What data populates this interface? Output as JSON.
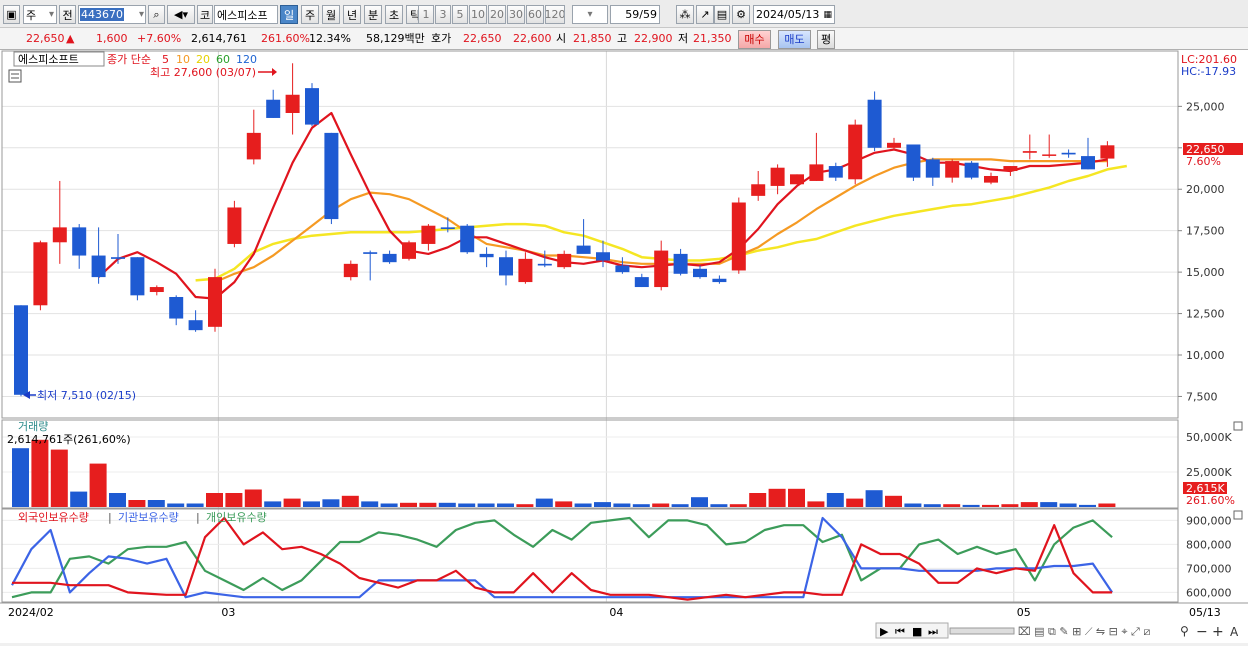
{
  "toolbar": {
    "market": "주",
    "period_prefix": "전",
    "code": "443670",
    "type_label": "코",
    "stock_name": "에스피소프",
    "periods": [
      "일",
      "주",
      "월",
      "년",
      "분",
      "초",
      "틱"
    ],
    "active_period": "일",
    "minute_opts": [
      "1",
      "3",
      "5",
      "10",
      "20",
      "30",
      "60",
      "120"
    ],
    "count": "59",
    "count_total": "/59",
    "date": "2024/05/13"
  },
  "quote": {
    "price": "22,650",
    "arrow": "▲",
    "change": "1,600",
    "change_pct": "+7.60%",
    "volume": "2,614,761",
    "vol_ratio": "261.60%",
    "turnover": "12.34%",
    "amount": "58,129백만",
    "hoga_label": "호가",
    "ask": "22,650",
    "bid": "22,600",
    "open_label": "시",
    "open": "21,850",
    "high_label": "고",
    "high": "22,900",
    "low_label": "저",
    "low": "21,350",
    "buy": "매수",
    "sell": "매도",
    "eval": "평"
  },
  "colors": {
    "up": "#e61e1e",
    "down": "#1e5ad2",
    "ma5": "#e0141e",
    "ma10": "#f59a23",
    "ma20": "#f5e623",
    "ma60": "#2aa02a",
    "ma120": "#1e64d2",
    "foreign": "#e0141e",
    "inst": "#3c64e6",
    "person": "#3c9c5a"
  },
  "chart_data": [
    {
      "type": "candlestick",
      "title": "에스피소프트",
      "legend_prefix": "종가 단순",
      "ma_periods": [
        "5",
        "10",
        "20",
        "60",
        "120"
      ],
      "high_note": "최고 27,600 (03/07)",
      "low_note": "최저 7,510 (02/15)",
      "right_top": [
        "LC:201.60",
        "HC:-17.93"
      ],
      "last_price_label": "22,650",
      "last_pct_label": "7.60%",
      "yticks": [
        "25,000",
        "22,500",
        "20,000",
        "17,500",
        "15,000",
        "12,500",
        "10,000",
        "7,500"
      ],
      "ytick_values": [
        25000,
        22500,
        20000,
        17500,
        15000,
        12500,
        10000,
        7500
      ],
      "ylim": [
        6200,
        28400
      ],
      "x_labels": [
        "2024/02",
        "03",
        "04",
        "05",
        "05/13"
      ],
      "x_label_index": [
        0,
        11,
        31,
        52,
        58
      ],
      "candles": [
        [
          13000,
          13000,
          7510,
          7600
        ],
        [
          13000,
          16900,
          12700,
          16800
        ],
        [
          16800,
          20500,
          15500,
          17700
        ],
        [
          17700,
          17900,
          15200,
          16000
        ],
        [
          16000,
          17700,
          14300,
          14700
        ],
        [
          15900,
          17300,
          15500,
          15800
        ],
        [
          15900,
          15900,
          13300,
          13600
        ],
        [
          13800,
          14200,
          13600,
          14100
        ],
        [
          13500,
          13600,
          11800,
          12200
        ],
        [
          12100,
          12700,
          11400,
          11500
        ],
        [
          11700,
          15200,
          11400,
          14700
        ],
        [
          16700,
          19300,
          16500,
          18900
        ],
        [
          21800,
          24800,
          21500,
          23400
        ],
        [
          25400,
          26000,
          24300,
          24300
        ],
        [
          24600,
          27600,
          23300,
          25700
        ],
        [
          26100,
          26400,
          23800,
          23900
        ],
        [
          23400,
          23400,
          17900,
          18200
        ],
        [
          14700,
          15700,
          14500,
          15500
        ],
        [
          16200,
          16300,
          14500,
          16100
        ],
        [
          16100,
          16300,
          15500,
          15600
        ],
        [
          15800,
          16900,
          15700,
          16800
        ],
        [
          16700,
          17900,
          16300,
          17800
        ],
        [
          17700,
          18300,
          17400,
          17600
        ],
        [
          17800,
          17900,
          16100,
          16200
        ],
        [
          16100,
          16500,
          15300,
          15900
        ],
        [
          15900,
          16300,
          14200,
          14800
        ],
        [
          14400,
          16200,
          14300,
          15800
        ],
        [
          15500,
          16300,
          15300,
          15400
        ],
        [
          15300,
          16300,
          15200,
          16100
        ],
        [
          16600,
          18200,
          16200,
          16100
        ],
        [
          16200,
          16900,
          15300,
          15700
        ],
        [
          15400,
          15900,
          14900,
          15000
        ],
        [
          14700,
          14900,
          14100,
          14100
        ],
        [
          14100,
          16900,
          13900,
          16300
        ],
        [
          16100,
          16400,
          14800,
          14900
        ],
        [
          15200,
          15400,
          14600,
          14700
        ],
        [
          14600,
          14800,
          14300,
          14400
        ],
        [
          15100,
          19500,
          14900,
          19200
        ],
        [
          19600,
          21100,
          19300,
          20300
        ],
        [
          20200,
          21500,
          19700,
          21300
        ],
        [
          20300,
          20900,
          20300,
          20900
        ],
        [
          20500,
          23400,
          20500,
          21500
        ],
        [
          21400,
          21600,
          20500,
          20700
        ],
        [
          20600,
          24200,
          20300,
          23900
        ],
        [
          25400,
          25900,
          22300,
          22500
        ],
        [
          22500,
          23100,
          22400,
          22800
        ],
        [
          22700,
          22700,
          20500,
          20700
        ],
        [
          21800,
          21900,
          20200,
          20700
        ],
        [
          20700,
          21800,
          20400,
          21700
        ],
        [
          21600,
          21700,
          20600,
          20700
        ],
        [
          20400,
          21000,
          20300,
          20800
        ],
        [
          21100,
          21400,
          20800,
          21400
        ],
        [
          22200,
          23300,
          21800,
          22300
        ],
        [
          22100,
          23300,
          21900,
          22100
        ],
        [
          22200,
          22400,
          21900,
          22100
        ],
        [
          22000,
          23100,
          21200,
          21200
        ],
        [
          21850,
          22900,
          21350,
          22650
        ]
      ],
      "ma5": [
        null,
        null,
        null,
        null,
        14700,
        15800,
        16200,
        15600,
        14900,
        13500,
        13400,
        14400,
        16100,
        18900,
        21600,
        23700,
        24600,
        22100,
        19700,
        17500,
        16300,
        16100,
        16500,
        17100,
        17100,
        16700,
        16300,
        15900,
        15600,
        15500,
        15700,
        15400,
        15300,
        15400,
        15500,
        15400,
        15600,
        16400,
        17600,
        19100,
        20200,
        21000,
        21200,
        21700,
        22200,
        22400,
        22100,
        21600,
        21600,
        21400,
        21200,
        21100,
        21400,
        21400,
        21500,
        21600,
        21800
      ],
      "ma10": [
        null,
        null,
        null,
        null,
        null,
        null,
        null,
        null,
        null,
        null,
        14400,
        14900,
        15300,
        16000,
        16900,
        17800,
        18700,
        19400,
        19800,
        19700,
        19400,
        18800,
        18200,
        17400,
        16700,
        16500,
        16300,
        16000,
        16000,
        15900,
        15800,
        15600,
        15500,
        15500,
        15500,
        15500,
        15500,
        16000,
        16500,
        17300,
        18000,
        18800,
        19500,
        20200,
        20800,
        21300,
        21600,
        21800,
        21800,
        21800,
        21800,
        21700,
        21700,
        21700,
        21700,
        21700,
        21700
      ],
      "ma20": [
        null,
        null,
        null,
        null,
        null,
        null,
        null,
        null,
        null,
        14500,
        14600,
        15200,
        16200,
        16700,
        17000,
        17200,
        17300,
        17400,
        17400,
        17400,
        17400,
        17500,
        17600,
        17700,
        17800,
        17900,
        17900,
        17800,
        17400,
        17200,
        16800,
        16400,
        15900,
        15800,
        15700,
        15700,
        15800,
        16000,
        16300,
        16500,
        16800,
        17000,
        17400,
        17800,
        18100,
        18400,
        18600,
        18800,
        19000,
        19100,
        19300,
        19500,
        19800,
        20100,
        20500,
        20800,
        21200,
        21400
      ],
      "volume": {
        "ticks": [
          "50,000K",
          "25,000K"
        ],
        "tick_values": [
          50000,
          25000
        ],
        "ylim": [
          0,
          60000
        ],
        "title": "거래량",
        "label": "2,614,761주(261,60%)",
        "last_label": "2,615K",
        "last_pct": "261.60%",
        "values": [
          42000,
          48000,
          41000,
          11000,
          31000,
          10000,
          5000,
          5000,
          2500,
          2500,
          10000,
          10000,
          12500,
          4000,
          6000,
          4000,
          5500,
          8000,
          4000,
          2500,
          3000,
          3000,
          3000,
          2500,
          2500,
          2500,
          2000,
          6000,
          4000,
          2500,
          3500,
          2500,
          2000,
          2500,
          2000,
          7000,
          2000,
          2000,
          10000,
          13000,
          13000,
          4000,
          10000,
          6000,
          12000,
          8000,
          2500,
          2000,
          2000,
          1500,
          1500,
          2000,
          3500,
          3500,
          2500,
          1500,
          2500
        ],
        "up": [
          false,
          true,
          true,
          false,
          true,
          false,
          true,
          false,
          false,
          false,
          true,
          true,
          true,
          false,
          true,
          false,
          false,
          true,
          false,
          false,
          true,
          true,
          false,
          false,
          false,
          false,
          true,
          false,
          true,
          false,
          false,
          false,
          false,
          true,
          false,
          false,
          false,
          true,
          true,
          true,
          true,
          true,
          false,
          true,
          false,
          true,
          false,
          false,
          true,
          false,
          true,
          true,
          true,
          false,
          false,
          false,
          true
        ]
      },
      "holdings": {
        "series_names": [
          "외국인보유수량",
          "기관보유수량",
          "개인보유수량"
        ],
        "ticks": [
          "900,000",
          "800,000",
          "700,000",
          "600,000"
        ],
        "tick_values": [
          900000,
          800000,
          700000,
          600000
        ],
        "ylim": [
          560000,
          935000
        ],
        "foreign": [
          640000,
          640000,
          640000,
          630000,
          630000,
          630000,
          600000,
          595000,
          590000,
          590000,
          830000,
          910000,
          800000,
          850000,
          780000,
          790000,
          760000,
          720000,
          660000,
          640000,
          620000,
          650000,
          650000,
          690000,
          620000,
          600000,
          600000,
          680000,
          600000,
          680000,
          610000,
          590000,
          590000,
          590000,
          580000,
          570000,
          580000,
          590000,
          580000,
          590000,
          600000,
          600000,
          590000,
          590000,
          800000,
          760000,
          760000,
          720000,
          640000,
          640000,
          700000,
          680000,
          700000,
          690000,
          880000,
          680000,
          600000,
          600000
        ],
        "inst": [
          630000,
          780000,
          860000,
          600000,
          680000,
          750000,
          740000,
          720000,
          740000,
          580000,
          600000,
          590000,
          580000,
          580000,
          580000,
          580000,
          580000,
          580000,
          580000,
          650000,
          650000,
          650000,
          650000,
          650000,
          650000,
          580000,
          580000,
          580000,
          580000,
          580000,
          580000,
          580000,
          580000,
          580000,
          580000,
          580000,
          580000,
          580000,
          580000,
          580000,
          580000,
          580000,
          910000,
          830000,
          700000,
          700000,
          700000,
          690000,
          690000,
          690000,
          690000,
          700000,
          700000,
          700000,
          710000,
          710000,
          720000,
          600000
        ],
        "person": [
          580000,
          600000,
          600000,
          740000,
          750000,
          720000,
          780000,
          790000,
          790000,
          810000,
          690000,
          650000,
          610000,
          660000,
          610000,
          650000,
          730000,
          810000,
          810000,
          850000,
          840000,
          820000,
          790000,
          860000,
          890000,
          900000,
          840000,
          790000,
          860000,
          820000,
          890000,
          900000,
          910000,
          830000,
          900000,
          900000,
          880000,
          800000,
          810000,
          860000,
          880000,
          880000,
          810000,
          840000,
          650000,
          700000,
          700000,
          800000,
          820000,
          760000,
          790000,
          760000,
          780000,
          650000,
          800000,
          870000,
          900000,
          830000
        ]
      }
    }
  ],
  "bottom": {
    "icons": [
      "play-icon",
      "rewind-icon",
      "stop-icon",
      "forward-icon"
    ]
  }
}
